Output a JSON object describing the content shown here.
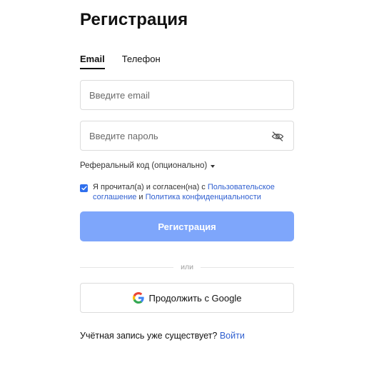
{
  "title": "Регистрация",
  "tabs": [
    {
      "label": "Email",
      "active": true
    },
    {
      "label": "Телефон",
      "active": false
    }
  ],
  "email_field": {
    "value": "",
    "placeholder": "Введите email"
  },
  "password_field": {
    "value": "",
    "placeholder": "Введите пароль",
    "toggle_icon": "eye-off-icon"
  },
  "referral": {
    "label": "Реферальный код (опционально)",
    "icon": "caret-down-icon"
  },
  "agreement": {
    "checked": true,
    "text_prefix": "Я прочитал(а) и согласен(на) с",
    "terms_link": "Пользовательское соглашение",
    "conjunction": "и",
    "privacy_link": "Политика конфиденциальности"
  },
  "submit_label": "Регистрация",
  "divider_label": "или",
  "google_button": {
    "label": "Продолжить с Google",
    "icon": "google-logo-icon"
  },
  "login_prompt": {
    "text": "Учётная запись уже существует?",
    "link": "Войти"
  },
  "colors": {
    "accent": "#2f6fed",
    "submit_bg_disabled": "#7ea6fb",
    "link": "#2f5fd0",
    "border": "#dcdcdc"
  }
}
